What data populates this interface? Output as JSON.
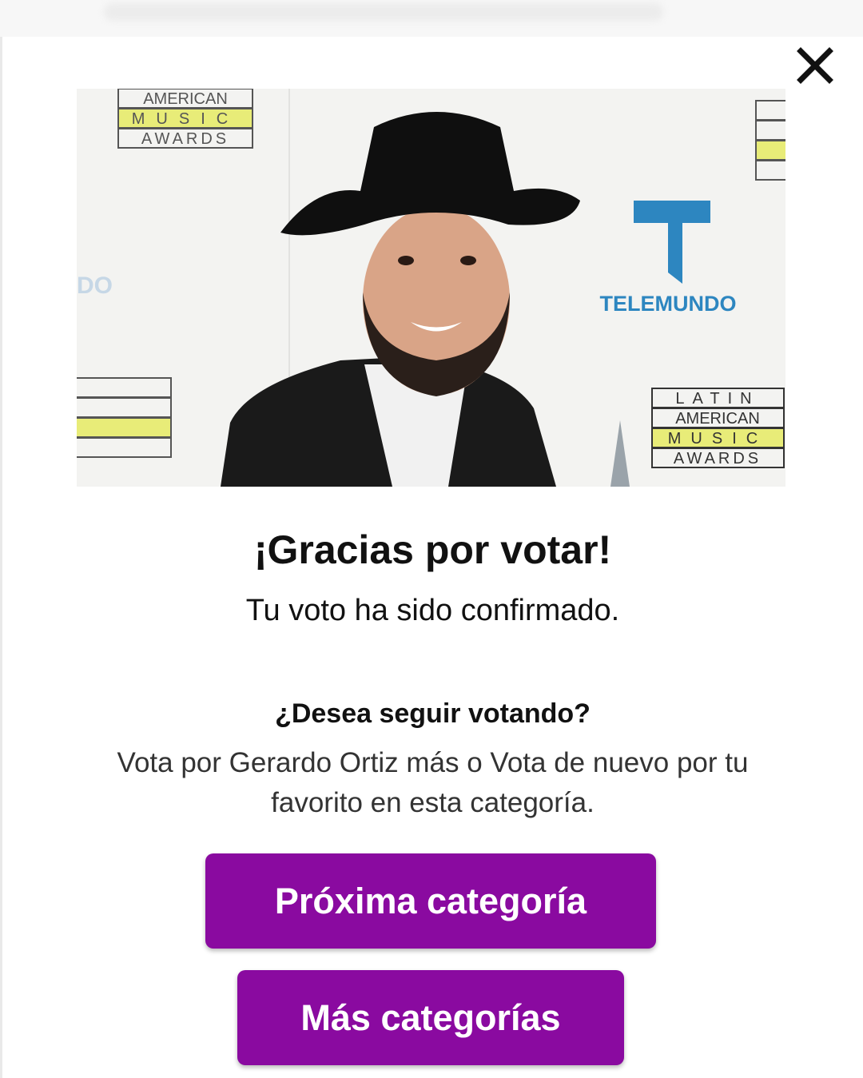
{
  "dialog": {
    "close_icon": "close-icon",
    "photo": {
      "backdrop_logos": [
        {
          "line1": "AMERICAN",
          "line2": "MUSIC",
          "line3": "AWARDS"
        },
        {
          "line1": "LATIN",
          "line2": "AMERICAN",
          "line3": "MUSIC",
          "line4": "AWARDS"
        }
      ],
      "sponsor_text": "TELEMUNDO",
      "partial_text": "DO"
    },
    "title": "¡Gracias por votar!",
    "subtitle": "Tu voto ha sido confirmado.",
    "question": "¿Desea seguir votando?",
    "description": "Vota por Gerardo Ortiz más o Vota de nuevo por tu favorito en esta categoría.",
    "buttons": {
      "next_label": "Próxima categoría",
      "more_label": "Más categorías"
    }
  },
  "colors": {
    "button_bg": "#8a0aa0",
    "button_text": "#ffffff",
    "brand_blue": "#2d86c0",
    "logo_yellow": "#e8ec78"
  }
}
